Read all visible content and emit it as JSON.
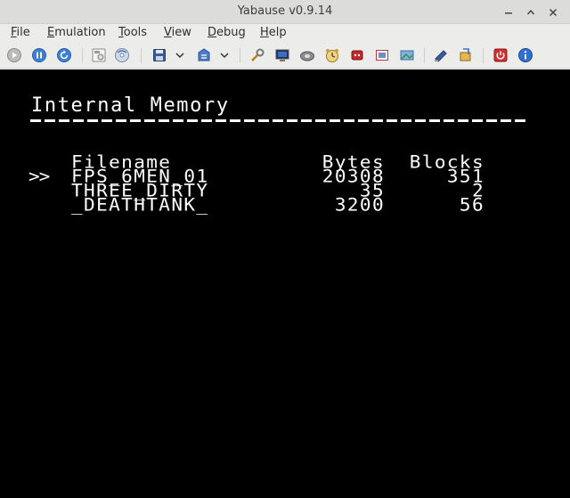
{
  "window": {
    "title": "Yabause v0.9.14"
  },
  "menubar": {
    "items": [
      {
        "label": "File",
        "mnemonic": "F",
        "rest": "ile"
      },
      {
        "label": "Emulation",
        "mnemonic": "E",
        "rest": "mulation"
      },
      {
        "label": "Tools",
        "mnemonic": "T",
        "rest": "ools"
      },
      {
        "label": "View",
        "mnemonic": "V",
        "rest": "iew"
      },
      {
        "label": "Debug",
        "mnemonic": "D",
        "rest": "ebug"
      },
      {
        "label": "Help",
        "mnemonic": "H",
        "rest": "elp"
      }
    ]
  },
  "toolbar": {
    "icons": [
      "run-icon",
      "pause-icon",
      "reset-icon",
      "open-iso-icon",
      "open-cdrom-icon",
      "save-state-icon",
      "load-state-icon",
      "settings-icon",
      "vdp1-icon",
      "cdrom-drive-icon",
      "timer-icon",
      "cartridge-icon",
      "fullscreen-icon",
      "screenshot-icon",
      "memory-editor-icon",
      "transfer-icon",
      "quit-icon",
      "about-icon"
    ]
  },
  "screen": {
    "heading": "Internal Memory",
    "cursor": ">>",
    "columns": {
      "filename": "Filename",
      "bytes": "Bytes",
      "blocks": "Blocks"
    },
    "files": [
      {
        "name": "FPS_6MEN_01",
        "bytes": "20308",
        "blocks": "351"
      },
      {
        "name": "THREE_DIRTY",
        "bytes": "35",
        "blocks": "2"
      },
      {
        "name": "_DEATHTANK_",
        "bytes": "3200",
        "blocks": "56"
      }
    ]
  }
}
